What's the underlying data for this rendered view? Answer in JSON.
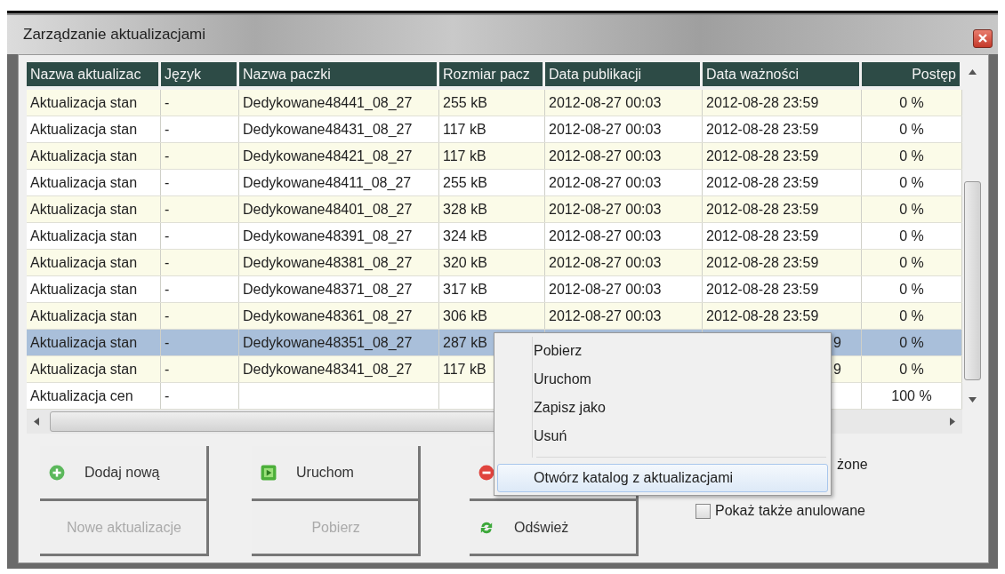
{
  "window": {
    "title": "Zarządzanie aktualizacjami"
  },
  "table": {
    "columns": [
      "Nazwa aktualizac",
      "Język",
      "Nazwa paczki",
      "Rozmiar pacz",
      "Data publikacji",
      "Data ważności",
      "Postęp"
    ],
    "rows": [
      {
        "selected": false,
        "cells": [
          "Aktualizacja stan",
          "-",
          "Dedykowane48441_08_27",
          "255 kB",
          "2012-08-27 00:03",
          "2012-08-28 23:59",
          "0 %"
        ]
      },
      {
        "selected": false,
        "cells": [
          "Aktualizacja stan",
          "-",
          "Dedykowane48431_08_27",
          "117 kB",
          "2012-08-27 00:03",
          "2012-08-28 23:59",
          "0 %"
        ]
      },
      {
        "selected": false,
        "cells": [
          "Aktualizacja stan",
          "-",
          "Dedykowane48421_08_27",
          "117 kB",
          "2012-08-27 00:03",
          "2012-08-28 23:59",
          "0 %"
        ]
      },
      {
        "selected": false,
        "cells": [
          "Aktualizacja stan",
          "-",
          "Dedykowane48411_08_27",
          "255 kB",
          "2012-08-27 00:03",
          "2012-08-28 23:59",
          "0 %"
        ]
      },
      {
        "selected": false,
        "cells": [
          "Aktualizacja stan",
          "-",
          "Dedykowane48401_08_27",
          "328 kB",
          "2012-08-27 00:03",
          "2012-08-28 23:59",
          "0 %"
        ]
      },
      {
        "selected": false,
        "cells": [
          "Aktualizacja stan",
          "-",
          "Dedykowane48391_08_27",
          "324 kB",
          "2012-08-27 00:03",
          "2012-08-28 23:59",
          "0 %"
        ]
      },
      {
        "selected": false,
        "cells": [
          "Aktualizacja stan",
          "-",
          "Dedykowane48381_08_27",
          "320 kB",
          "2012-08-27 00:03",
          "2012-08-28 23:59",
          "0 %"
        ]
      },
      {
        "selected": false,
        "cells": [
          "Aktualizacja stan",
          "-",
          "Dedykowane48371_08_27",
          "317 kB",
          "2012-08-27 00:03",
          "2012-08-28 23:59",
          "0 %"
        ]
      },
      {
        "selected": false,
        "cells": [
          "Aktualizacja stan",
          "-",
          "Dedykowane48361_08_27",
          "306 kB",
          "2012-08-27 00:03",
          "2012-08-28 23:59",
          "0 %"
        ]
      },
      {
        "selected": true,
        "cells": [
          "Aktualizacja stan",
          "-",
          "Dedykowane48351_08_27",
          "287 kB",
          null,
          {
            "text": "9",
            "cut": true
          },
          "0 %"
        ]
      },
      {
        "selected": false,
        "cells": [
          "Aktualizacja stan",
          "-",
          "Dedykowane48341_08_27",
          "117 kB",
          null,
          {
            "text": "9",
            "cut": true
          },
          "0 %"
        ]
      },
      {
        "selected": false,
        "cells": [
          "Aktualizacja cen",
          "-",
          null,
          null,
          null,
          null,
          "100 %"
        ]
      }
    ]
  },
  "button_columns": [
    [
      {
        "kind": "add",
        "label": "Dodaj nową",
        "disabled": false
      },
      {
        "kind": "plain",
        "label": "Nowe aktualizacje",
        "disabled": true
      }
    ],
    [
      {
        "kind": "run",
        "label": "Uruchom",
        "disabled": false
      },
      {
        "kind": "plain",
        "label": "Pobierz",
        "disabled": true
      }
    ],
    [
      {
        "kind": "remove",
        "disabled": false
      },
      {
        "kind": "refresh",
        "label": "Odśwież",
        "disabled": false
      }
    ]
  ],
  "checkboxes": [
    {
      "label": "żone",
      "cut": true
    },
    {
      "label": "Pokaż także anulowane",
      "checked": false
    }
  ],
  "context_menu": {
    "items": [
      {
        "label": "Pobierz",
        "selected": false
      },
      {
        "label": "Uruchom",
        "selected": false
      },
      {
        "label": "Zapisz jako",
        "selected": false
      },
      {
        "label": "Usuń",
        "selected": false
      },
      {
        "kind": "separator"
      },
      {
        "label": "Otwórz katalog z aktualizacjami",
        "selected": true
      }
    ]
  }
}
